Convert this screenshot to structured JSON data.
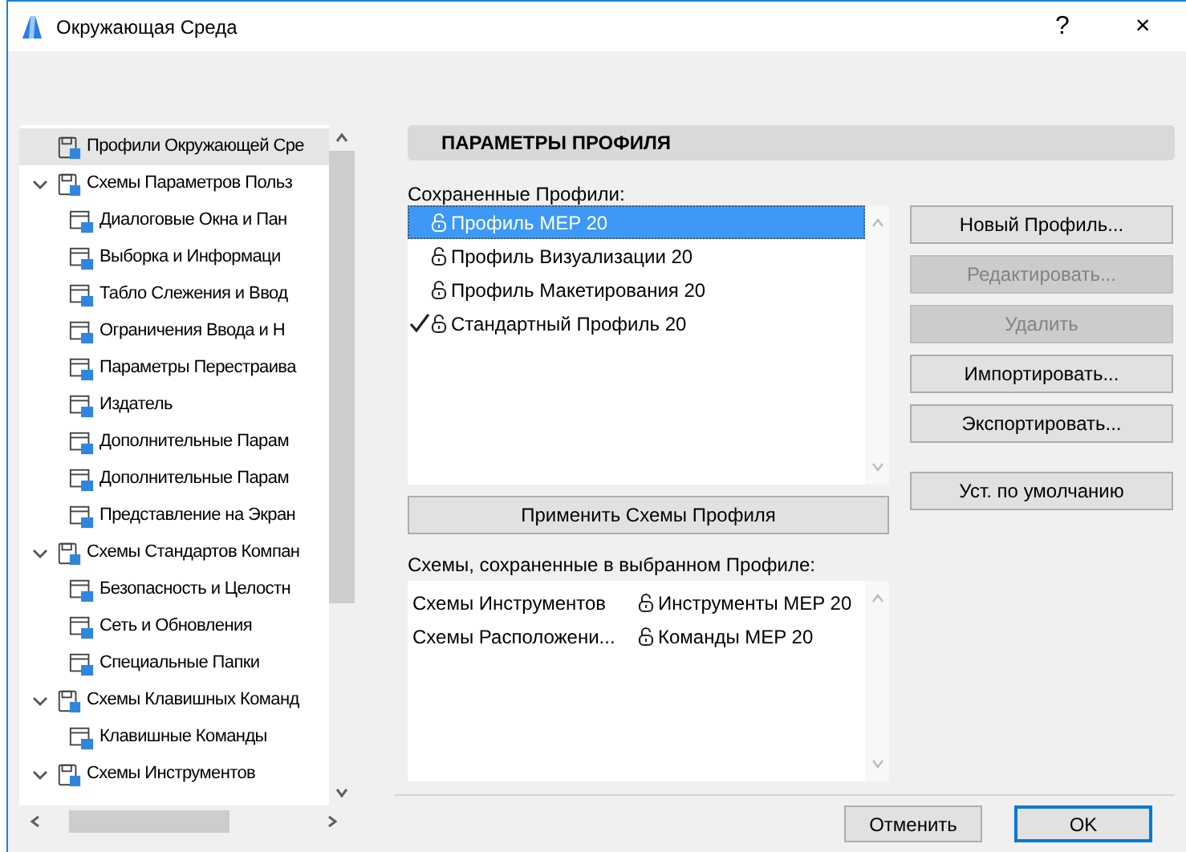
{
  "window": {
    "title": "Окружающая Среда",
    "help": "?",
    "close": "×"
  },
  "tree": [
    {
      "label": "Профили Окружающей Сре",
      "selected": true
    },
    {
      "label": "Схемы Параметров Польз",
      "selected": false,
      "expanded": true,
      "children": [
        {
          "label": "Диалоговые Окна и Пан",
          "selected": false
        },
        {
          "label": "Выборка и Информаци",
          "selected": false
        },
        {
          "label": "Табло Слежения и Ввод",
          "selected": false
        },
        {
          "label": "Ограничения Ввода и Н",
          "selected": false
        },
        {
          "label": "Параметры Перестраива",
          "selected": false
        },
        {
          "label": "Издатель",
          "selected": false
        },
        {
          "label": "Дополнительные Парам",
          "selected": false
        },
        {
          "label": "Дополнительные Парам",
          "selected": false
        },
        {
          "label": "Представление на Экран",
          "selected": false
        }
      ]
    },
    {
      "label": "Схемы Стандартов Компан",
      "selected": false,
      "expanded": true,
      "children": [
        {
          "label": "Безопасность и Целостн",
          "selected": false
        },
        {
          "label": "Сеть и Обновления",
          "selected": false
        },
        {
          "label": "Специальные Папки",
          "selected": false
        }
      ]
    },
    {
      "label": "Схемы Клавишных Команд",
      "selected": false,
      "expanded": true,
      "children": [
        {
          "label": "Клавишные Команды",
          "selected": false
        }
      ]
    },
    {
      "label": "Схемы Инструментов",
      "selected": false,
      "expanded": true
    }
  ],
  "panel": {
    "header": "ПАРАМЕТРЫ ПРОФИЛЯ",
    "profiles_label": "Сохраненные Профили:",
    "profiles": [
      {
        "label": "Профиль MEP 20",
        "selected": true,
        "checked": false,
        "locked": true
      },
      {
        "label": "Профиль Визуализации 20",
        "selected": false,
        "checked": false,
        "locked": true
      },
      {
        "label": "Профиль Макетирования 20",
        "selected": false,
        "checked": false,
        "locked": true
      },
      {
        "label": "Стандартный Профиль 20",
        "selected": false,
        "checked": true,
        "locked": true
      }
    ],
    "buttons": [
      {
        "label": "Новый Профиль...",
        "disabled": false
      },
      {
        "label": "Редактировать...",
        "disabled": true
      },
      {
        "label": "Удалить",
        "disabled": true
      },
      {
        "label": "Импортировать...",
        "disabled": false
      },
      {
        "label": "Экспортировать...",
        "disabled": false
      },
      {
        "label": "Уст. по умолчанию",
        "disabled": false
      }
    ],
    "apply_button": "Применить Схемы Профиля",
    "schemes_label": "Схемы, сохраненные в выбранном Профиле:",
    "schemes": [
      {
        "name": "Схемы Инструментов",
        "value": "Инструменты MEP 20",
        "locked": true
      },
      {
        "name": "Схемы Расположени...",
        "value": "Команды MEP 20",
        "locked": true
      }
    ]
  },
  "footer": [
    {
      "label": "Отменить",
      "default": false
    },
    {
      "label": "OK",
      "default": true
    }
  ]
}
